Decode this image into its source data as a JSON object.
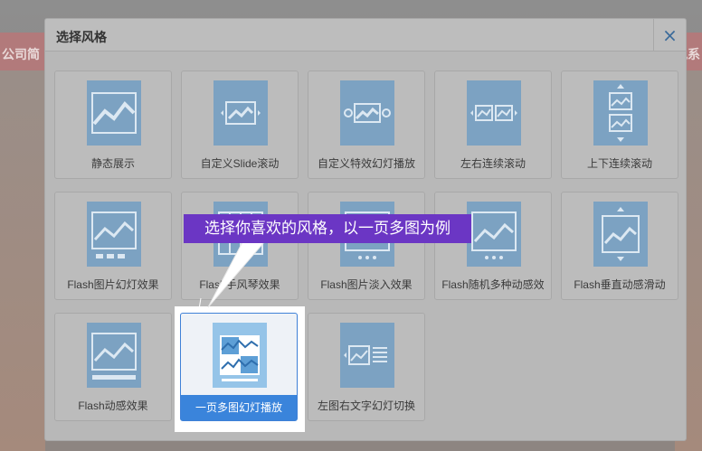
{
  "background": {
    "banner_left_text": "公司简",
    "banner_right_text": "风系"
  },
  "modal": {
    "title": "选择风格",
    "close_glyph": "×"
  },
  "styles": [
    {
      "label": "静态展示",
      "icon": "static-image-icon"
    },
    {
      "label": "自定义Slide滚动",
      "icon": "slide-scroll-icon"
    },
    {
      "label": "自定义特效幻灯播放",
      "icon": "effect-slideshow-icon"
    },
    {
      "label": "左右连续滚动",
      "icon": "horizontal-scroll-icon"
    },
    {
      "label": "上下连续滚动",
      "icon": "vertical-scroll-icon"
    },
    {
      "label": "Flash图片幻灯效果",
      "icon": "flash-slideshow-icon"
    },
    {
      "label": "Flash手风琴效果",
      "icon": "flash-accordion-icon"
    },
    {
      "label": "Flash图片淡入效果",
      "icon": "flash-fade-icon"
    },
    {
      "label": "Flash随机多种动感效",
      "icon": "flash-random-icon"
    },
    {
      "label": "Flash垂直动感滑动",
      "icon": "flash-vertical-icon"
    },
    {
      "label": "Flash动感效果",
      "icon": "flash-dynamic-icon"
    },
    {
      "label": "一页多图幻灯播放",
      "icon": "multi-image-slideshow-icon",
      "selected": true
    },
    {
      "label": "左图右文字幻灯切换",
      "icon": "image-text-slideshow-icon"
    }
  ],
  "callout": {
    "text": "选择你喜欢的风格，以一页多图为例"
  },
  "colors": {
    "overlay": "#8e8e8e",
    "thumb": "#7ca2c2",
    "selected_accent": "#3a84db",
    "callout": "#6b36c4"
  }
}
